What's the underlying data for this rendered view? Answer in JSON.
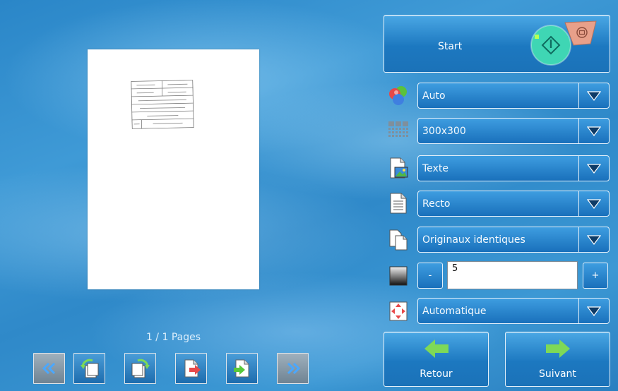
{
  "preview": {
    "page_counter": "1 / 1 Pages",
    "scanned_lines": [
      [
        "",
        ""
      ],
      [
        "",
        ""
      ],
      [
        ""
      ],
      [
        ""
      ],
      [
        ""
      ],
      [
        "",
        ""
      ]
    ]
  },
  "nav": {
    "first": "first-page",
    "rotate_left": "rotate-left",
    "rotate_right": "rotate-right",
    "delete_page": "delete-page",
    "insert_page": "insert-page",
    "last": "last-page"
  },
  "start": {
    "label": "Start"
  },
  "settings": {
    "color_mode": "Auto",
    "resolution": "300x300",
    "document_type": "Texte",
    "sides": "Recto",
    "originals": "Originaux identiques",
    "density_value": "5",
    "density_minus": "-",
    "density_plus": "+",
    "size": "Automatique"
  },
  "footer": {
    "back_label": "Retour",
    "next_label": "Suivant"
  },
  "colors": {
    "accent": "#1c78c0",
    "green_arrow": "#7ed957",
    "start_green": "#3fd6b4",
    "stop_orange": "#e8a08a"
  }
}
